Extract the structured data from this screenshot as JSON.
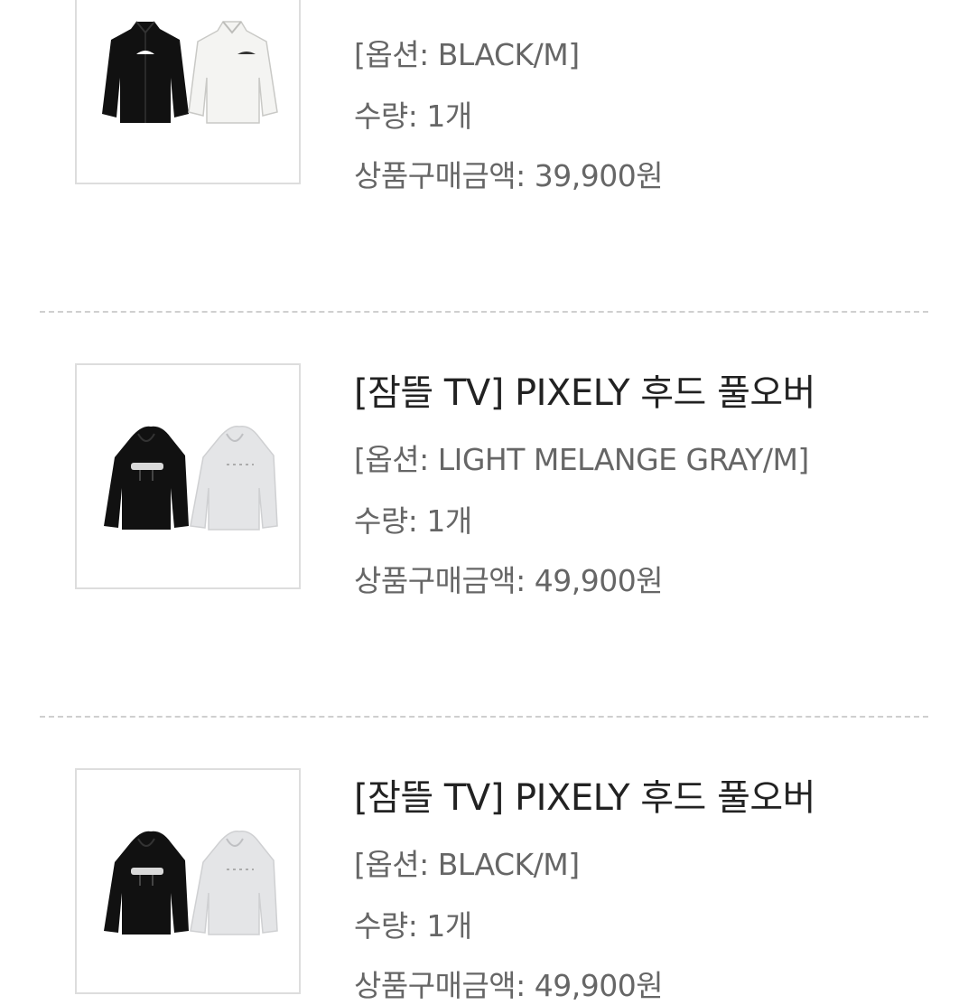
{
  "items": [
    {
      "title": "",
      "option": "[옵션: BLACK/M]",
      "quantity": "수량: 1개",
      "price": "상품구매금액: 39,900원",
      "image_icon": "jacket-pair-icon"
    },
    {
      "title": "[잠뜰 TV] PIXELY 후드 풀오버",
      "option": "[옵션: LIGHT MELANGE GRAY/M]",
      "quantity": "수량: 1개",
      "price": "상품구매금액: 49,900원",
      "image_icon": "hoodie-pair-icon"
    },
    {
      "title": "[잠뜰 TV] PIXELY 후드 풀오버",
      "option": "[옵션: BLACK/M]",
      "quantity": "수량: 1개",
      "price": "상품구매금액: 49,900원",
      "image_icon": "hoodie-pair-icon"
    }
  ],
  "colors": {
    "title_text": "#222222",
    "detail_text": "#666666",
    "divider": "#cfcfcf",
    "thumb_border": "#dddddd",
    "garment_black": "#111111",
    "garment_white": "#f4f4f2",
    "garment_gray": "#e4e5e7"
  }
}
